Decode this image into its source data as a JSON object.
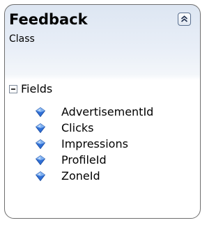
{
  "class_shape": {
    "name": "Feedback",
    "kind": "Class",
    "collapse_icon": "double-chevron-up-icon"
  },
  "fields_section": {
    "label": "Fields",
    "expander_icon": "minus-box-icon",
    "field_icon": "field-diamond-icon",
    "accent_color": "#2f6fd6",
    "items": [
      {
        "name": "AdvertisementId"
      },
      {
        "name": "Clicks"
      },
      {
        "name": "Impressions"
      },
      {
        "name": "ProfileId"
      },
      {
        "name": "ZoneId"
      }
    ]
  }
}
